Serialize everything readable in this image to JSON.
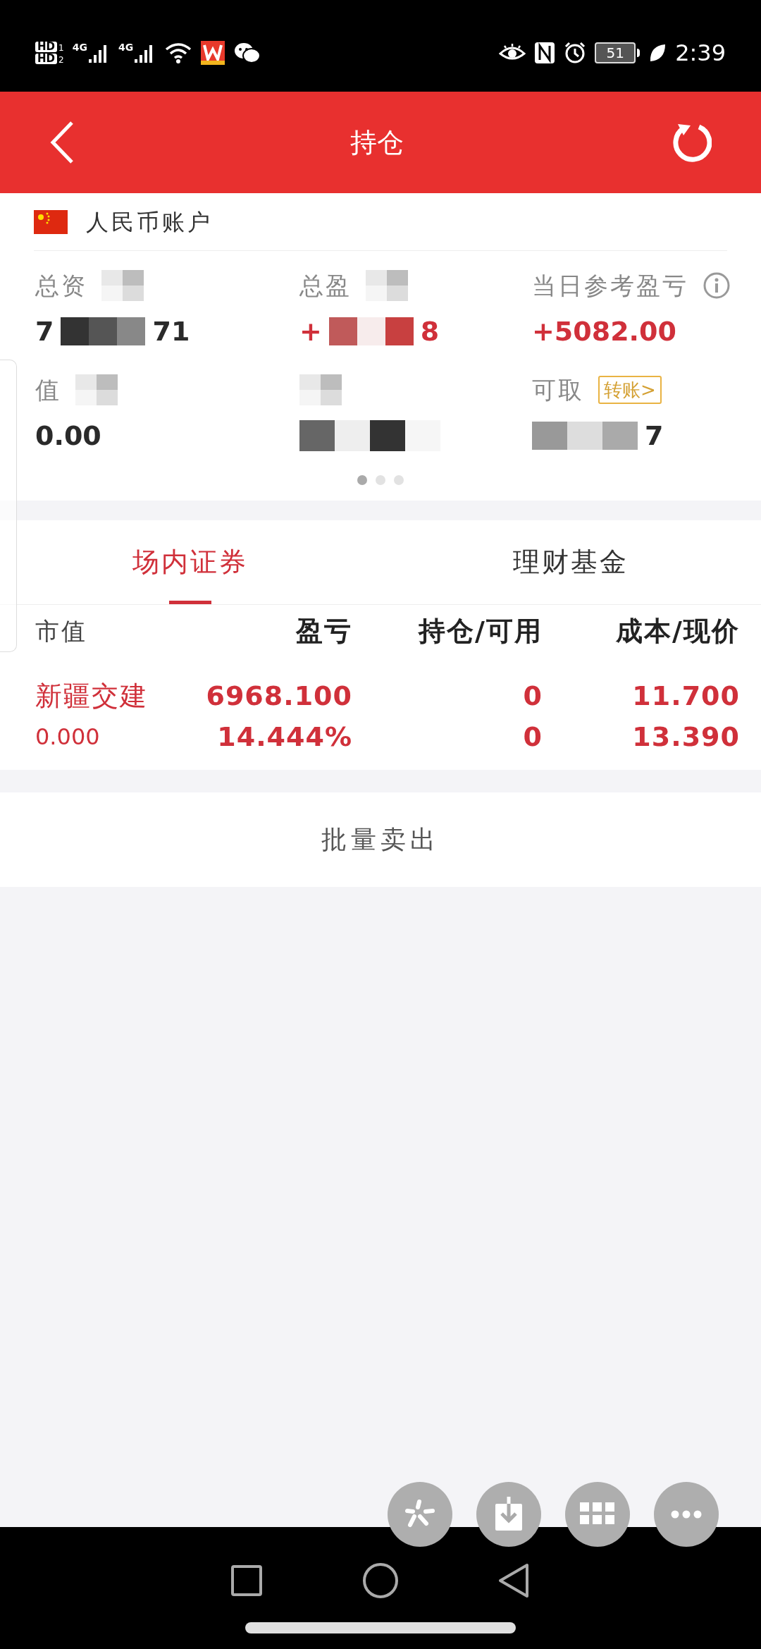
{
  "status_bar": {
    "sim_badges": [
      {
        "label": "HD",
        "slot": "1"
      },
      {
        "label": "HD",
        "slot": "2"
      }
    ],
    "networks": [
      "4G",
      "4G"
    ],
    "battery": "51",
    "time": "2:39"
  },
  "header": {
    "title": "持仓"
  },
  "account": {
    "name": "人民币账户"
  },
  "summary": [
    {
      "kind": "plain",
      "label": "总资",
      "value": [
        "7",
        "71"
      ],
      "color": "#2a2a2a"
    },
    {
      "kind": "plain",
      "label": "总盈",
      "value": [
        "+",
        "8"
      ],
      "color": "#d0303a"
    },
    {
      "kind": "info",
      "label": "当日参考盈亏",
      "value": [
        "+5082.00"
      ],
      "color": "#d0303a"
    },
    {
      "kind": "plain",
      "label": "值",
      "value": [
        "0.00"
      ],
      "color": "#2a2a2a"
    },
    {
      "kind": "masked"
    },
    {
      "kind": "action",
      "label": "可取",
      "value": [
        "7"
      ],
      "color": "#2a2a2a",
      "action": "转账>"
    }
  ],
  "pager": [
    {
      "selected": true
    },
    {
      "selected": false
    },
    {
      "selected": false
    }
  ],
  "tabs": [
    {
      "label": "场内证券",
      "selected": true
    },
    {
      "label": "理财基金",
      "selected": false
    }
  ],
  "table": {
    "columns": [
      "市值",
      "盈亏",
      "持仓/可用",
      "成本/现价"
    ],
    "rows": [
      {
        "cells": [
          [
            "新疆交建",
            "0.000"
          ],
          [
            "6968.100",
            "14.444%"
          ],
          [
            "0",
            "0"
          ],
          [
            "11.700",
            "13.390"
          ]
        ]
      }
    ]
  },
  "batch_button": "批量卖出"
}
